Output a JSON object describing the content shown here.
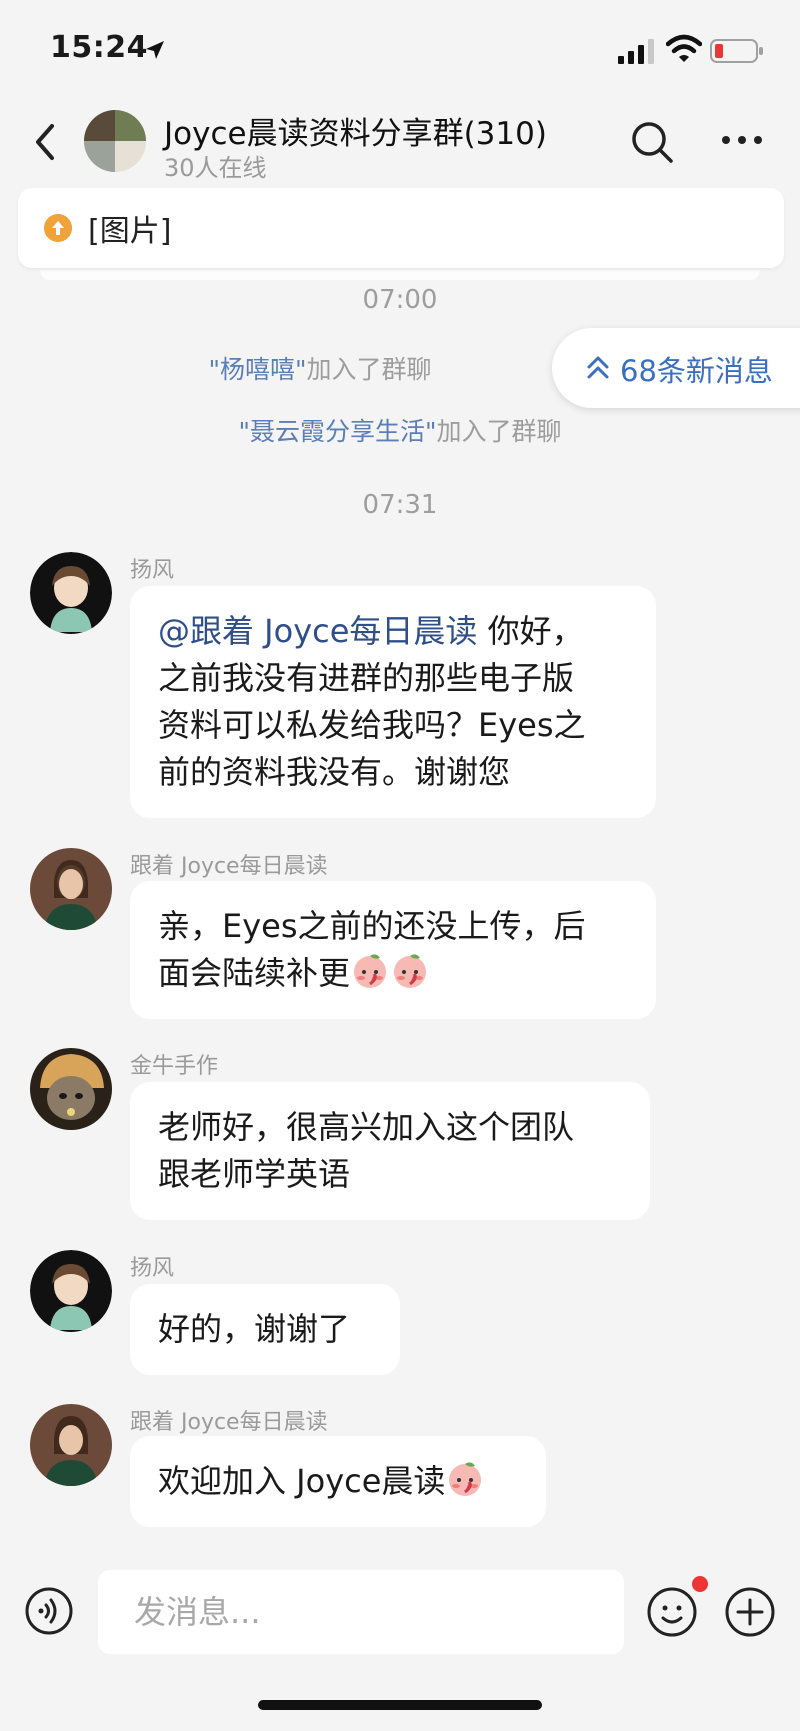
{
  "status_bar": {
    "time": "15:24"
  },
  "header": {
    "group_name": "Joyce晨读资料分享群(310)",
    "online": "30人在线"
  },
  "pinned": {
    "text": "[图片]"
  },
  "new_messages": {
    "label": "68条新消息"
  },
  "timeline": {
    "time1": "07:00",
    "joined1_name": "\"杨嘻嘻\"",
    "joined1_suffix": "加入了群聊",
    "joined2_name": "\"聂云霞分享生活\"",
    "joined2_suffix": "加入了群聊",
    "time2": "07:31"
  },
  "messages": [
    {
      "sender": "扬风",
      "mention": "@跟着 Joyce每日晨读",
      "lines": [
        " 你好，",
        "之前我没有进群的那些电子版",
        "资料可以私发给我吗？Eyes之",
        "前的资料我没有。谢谢您"
      ]
    },
    {
      "sender": "跟着 Joyce每日晨读",
      "lines": [
        "亲，Eyes之前的还没上传，后",
        "面会陆续补更"
      ]
    },
    {
      "sender": "金牛手作",
      "lines": [
        "老师好，很高兴加入这个团队",
        "跟老师学英语"
      ]
    },
    {
      "sender": "扬风",
      "lines": [
        "好的，谢谢了"
      ]
    },
    {
      "sender": "跟着 Joyce每日晨读",
      "lines": [
        "欢迎加入 Joyce晨读"
      ]
    }
  ],
  "input": {
    "placeholder": "发消息..."
  },
  "icons": {
    "back": "chevron-left-icon",
    "search": "search-icon",
    "more": "more-dots-icon",
    "voice": "voice-icon",
    "emoji": "emoji-icon",
    "plus": "plus-icon",
    "blush_emoji": "blush-peach-emoji"
  },
  "colors": {
    "accent": "#3b6fc0",
    "mention": "#2f4f8a",
    "system_name": "#5b7fb5",
    "badge_red": "#ee3434",
    "pin_orange": "#f0a23b"
  }
}
